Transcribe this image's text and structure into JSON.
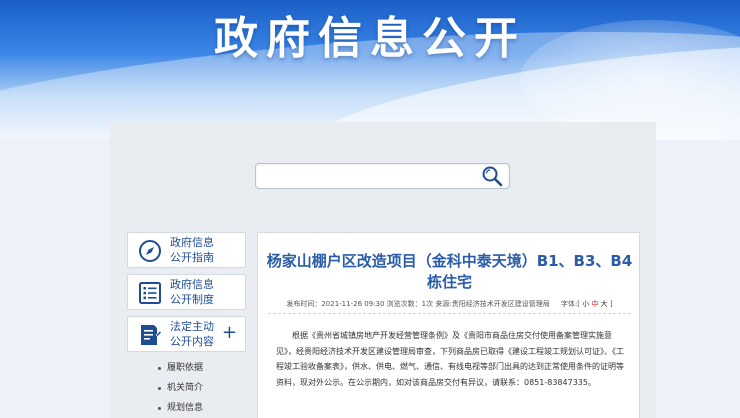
{
  "banner": {
    "title": "政府信息公开"
  },
  "search": {
    "value": "",
    "placeholder": ""
  },
  "sidebar": {
    "cards": [
      {
        "line1": "政府信息",
        "line2": "公开指南",
        "icon": "compass-icon"
      },
      {
        "line1": "政府信息",
        "line2": "公开制度",
        "icon": "list-icon"
      },
      {
        "line1": "法定主动",
        "line2": "公开内容",
        "icon": "document-edit-icon",
        "expand": "+"
      }
    ],
    "sub_items": [
      "履职依据",
      "机关简介",
      "规划信息"
    ]
  },
  "article": {
    "title": "杨家山棚户区改造项目（金科中泰天境）B1、B3、B4栋住宅",
    "meta": {
      "date_label": "发布时间：",
      "date": "2021-11-26 09:30",
      "views_label": "浏览次数：",
      "views": "1次",
      "source_label": "来源:",
      "source": "贵阳经济技术开发区建设管理局",
      "font_label": "字体:[",
      "font_small": "小",
      "font_mid": "中",
      "font_big": "大",
      "font_close": "]"
    },
    "body": "根据《贵州省城镇房地产开发经营管理条例》及《贵阳市商品住房交付使用备案管理实施意见》，经贵阳经济技术开发区建设管理局审查，下列商品房已取得《建设工程竣工规划认可证》、《工程竣工验收备案表》，供水、供电、燃气、通信、有线电视等部门出具的达到正常使用条件的证明等资料，现对外公示。在公示期内，如对该商品房交付有异议，请联系：0851-83847335。"
  },
  "colors": {
    "accent": "#2a5ca8",
    "banner_blue": "#1a5fc8",
    "font_mid": "#d02020"
  }
}
